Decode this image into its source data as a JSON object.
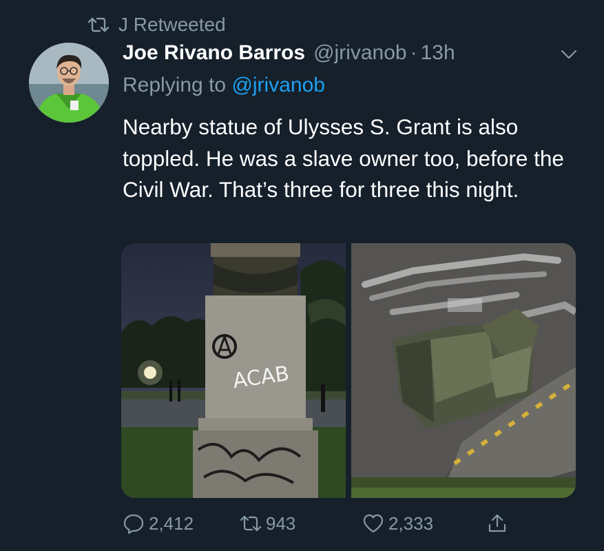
{
  "retweet": {
    "icon": "retweet-icon",
    "label": "J Retweeted"
  },
  "tweet": {
    "author_name": "Joe Rivano Barros",
    "author_handle": "@jrivanob",
    "separator": "·",
    "time": "13h",
    "replying_prefix": "Replying to",
    "replying_to": "@jrivanob",
    "text": "Nearby statue of Ulysses S. Grant is also toppled. He was a slave owner too, before the Civil War. That’s three for three this night.",
    "images": [
      {
        "name": "statue-pedestal-photo",
        "graffiti": "ACAB"
      },
      {
        "name": "toppled-statue-photo"
      }
    ]
  },
  "actions": {
    "reply_count": "2,412",
    "retweet_count": "943",
    "like_count": "2,333"
  },
  "colors": {
    "background": "#15202b",
    "secondary_text": "#8899a6",
    "link": "#1da1f2"
  }
}
